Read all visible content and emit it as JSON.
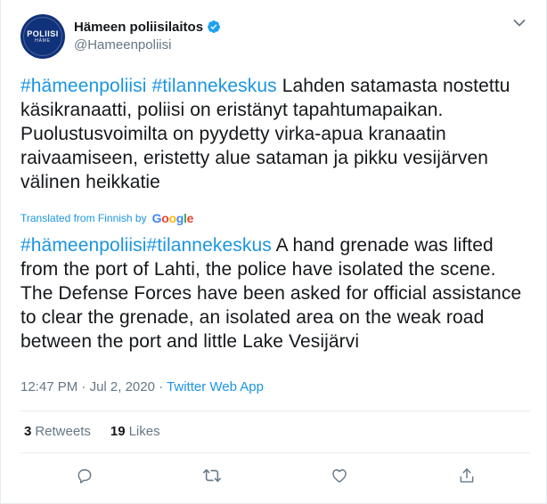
{
  "author": {
    "display_name": "Hämeen poliisilaitos",
    "handle": "@Hameenpoliisi",
    "avatar_line1": "POLIISI",
    "avatar_line2": "HÄME",
    "verified": true
  },
  "tweet": {
    "original": {
      "hashtags": [
        "#hämeenpoliisi",
        "#tilannekeskus"
      ],
      "body": "Lahden satamasta nostettu käsikranaatti, poliisi on eristänyt tapahtumapaikan. Puolustusvoimilta on pyydetty virka-apua kranaatin raivaamiseen, eristetty alue sataman ja pikku vesijärven välinen heikkatie"
    },
    "translation_label": "Translated from Finnish by",
    "translation_provider": "Google",
    "translated": {
      "hashtags": [
        "#hämeenpoliisi",
        "#tilannekeskus"
      ],
      "body": "A hand grenade was lifted from the port of Lahti, the police have isolated the scene. The Defense Forces have been asked for official assistance to clear the grenade, an isolated area on the weak road between the port and little Lake Vesijärvi"
    },
    "time": "12:47 PM",
    "date": "Jul 2, 2020",
    "separator": "·",
    "source": "Twitter Web App"
  },
  "stats": {
    "retweets_count": "3",
    "retweets_label": "Retweets",
    "likes_count": "19",
    "likes_label": "Likes"
  },
  "colors": {
    "accent": "#1b95e0",
    "secondary_text": "#657786",
    "avatar_bg": "#10327a"
  },
  "icons": [
    "verified-badge-icon",
    "chevron-down-icon",
    "reply-icon",
    "retweet-icon",
    "like-icon",
    "share-icon"
  ]
}
